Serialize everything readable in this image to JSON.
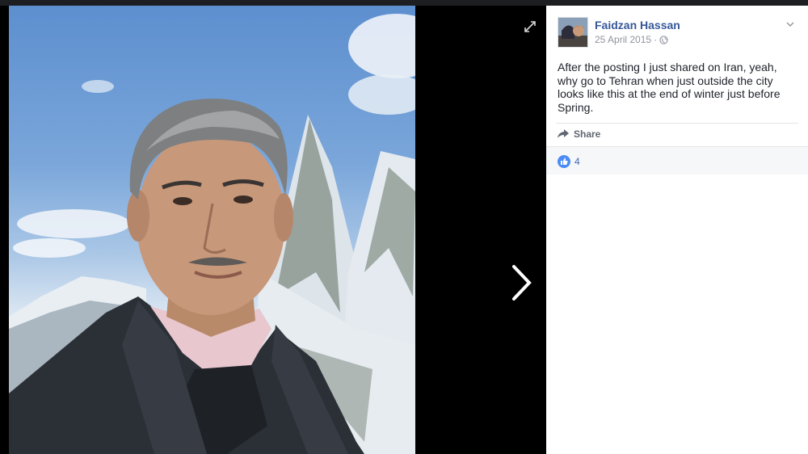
{
  "post": {
    "author": "Faidzan Hassan",
    "date": "25 April 2015",
    "separator": "·",
    "privacy_icon": "globe-icon",
    "text": "After the posting I just shared on Iran, yeah, why go to Tehran when just outside the city looks like this at the end of winter just before Spring.",
    "share_label": "Share",
    "like_count": "4"
  },
  "icons": {
    "expand": "expand-icon",
    "next": "chevron-right-icon",
    "options": "chevron-down-icon",
    "share": "share-arrow-icon",
    "like": "thumbs-up-icon"
  },
  "colors": {
    "link_blue": "#365899",
    "like_blue": "#4267b2",
    "meta_gray": "#90949c",
    "text": "#1d2129",
    "viewer_bg": "#000000"
  }
}
